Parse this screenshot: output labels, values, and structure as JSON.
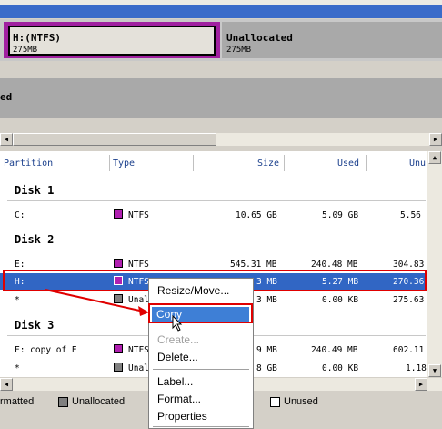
{
  "disk_map": {
    "partition_h": {
      "label": "H:(NTFS)",
      "size": "275MB"
    },
    "unallocated": {
      "label": "Unallocated",
      "size": "275MB"
    },
    "row2_label": "ed"
  },
  "columns": {
    "partition": "Partition",
    "type": "Type",
    "size": "Size",
    "used": "Used",
    "unused": "Unu"
  },
  "disks": [
    {
      "title": "Disk 1"
    },
    {
      "title": "Disk 2"
    },
    {
      "title": "Disk 3"
    }
  ],
  "rows": [
    {
      "partition": "C:",
      "type": "NTFS",
      "size": "10.65 GB",
      "used": "5.09 GB",
      "unused": "5.56",
      "color": "#b020b0"
    },
    {
      "partition": "E:",
      "type": "NTFS",
      "size": "545.31 MB",
      "used": "240.48 MB",
      "unused": "304.83",
      "color": "#b020b0"
    },
    {
      "partition": "H:",
      "type": "NTFS",
      "size": "3 MB",
      "used": "5.27 MB",
      "unused": "270.36",
      "color": "#b020b0"
    },
    {
      "partition": "*",
      "type": "Unal",
      "size": "3 MB",
      "used": "0.00 KB",
      "unused": "275.63",
      "color": "#808080"
    },
    {
      "partition": "F: copy of E",
      "type": "NTFS",
      "size": "9 MB",
      "used": "240.49 MB",
      "unused": "602.11",
      "color": "#b020b0"
    },
    {
      "partition": "*",
      "type": "Unal",
      "size": "8 GB",
      "used": "0.00 KB",
      "unused": "1.18",
      "color": "#808080"
    }
  ],
  "context_menu": {
    "items": [
      "Resize/Move...",
      "Copy",
      "Create...",
      "Delete...",
      "Label...",
      "Format...",
      "Properties"
    ],
    "highlighted": "Copy",
    "disabled": [
      "Create..."
    ]
  },
  "legend": {
    "formatted": "rmatted",
    "unallocated": "Unallocated",
    "unused": "Unused"
  },
  "colors": {
    "ntfs": "#b020b0",
    "unallocated": "#808080",
    "selection": "#3166c4",
    "annotation": "#e00000"
  }
}
